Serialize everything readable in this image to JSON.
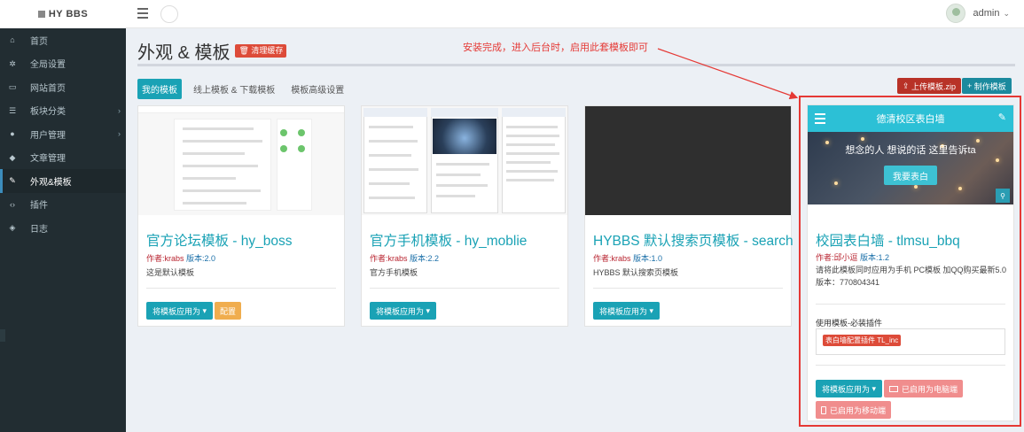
{
  "app": {
    "logo": "HY BBS"
  },
  "user": {
    "name": "admin",
    "caret": "⌄"
  },
  "sidebar": {
    "items": [
      {
        "label": "首页",
        "icon": "home-icon"
      },
      {
        "label": "全局设置",
        "icon": "gear-icon"
      },
      {
        "label": "网站首页",
        "icon": "monitor-icon"
      },
      {
        "label": "板块分类",
        "icon": "list-icon",
        "arrow": "›"
      },
      {
        "label": "用户管理",
        "icon": "users-icon",
        "arrow": "›"
      },
      {
        "label": "文章管理",
        "icon": "tag-icon"
      },
      {
        "label": "外观&模板",
        "icon": "brush-icon",
        "active": true
      },
      {
        "label": "插件",
        "icon": "code-icon"
      },
      {
        "label": "日志",
        "icon": "cube-icon"
      }
    ]
  },
  "page": {
    "title": "外观 & 模板",
    "clear_cache": "清理缓存",
    "annotation": "安装完成，进入后台时，启用此套模板即可"
  },
  "tabs": [
    {
      "label": "我的模板",
      "active": true
    },
    {
      "label": "线上模板 & 下载模板",
      "active": false
    },
    {
      "label": "模板高级设置",
      "active": false
    }
  ],
  "toolbar": {
    "upload": "上传模板.zip",
    "make": "制作模板"
  },
  "templates": [
    {
      "name": "官方论坛模板 - hy_boss",
      "author": "作者:krabs",
      "version": "版本:2.0",
      "desc": "这是默认模板",
      "apply": "将模板应用为",
      "config": "配置"
    },
    {
      "name": "官方手机模板 - hy_moblie",
      "author": "作者:krabs",
      "version": "版本:2.2",
      "desc": "官方手机模板",
      "apply": "将模板应用为"
    },
    {
      "name": "HYBBS 默认搜索页模板 - search",
      "author": "作者:krabs",
      "version": "版本:1.0",
      "desc": "HYBBS 默认搜索页模板",
      "apply": "将模板应用为"
    }
  ],
  "featured": {
    "header": "德清校区表白墙",
    "slogan": "想念的人 想说的话 这里告诉ta",
    "cta": "我要表白",
    "name": "校园表白墙 - tlmsu_bbq",
    "author": "作者:邱小逗",
    "version": "版本:1.2",
    "desc": "请将此模板同时应用为手机 PC模板 加QQ购买最新5.0版本：770804341",
    "plugins_label": "使用模板-必装插件",
    "plugin": "表白墙配置插件 TL_inc",
    "apply": "将模板应用为",
    "pc": "已启用为电脑端",
    "mobile": "已启用为移动端"
  },
  "colors": {
    "accent": "#1aa2b5",
    "sidebar_bg": "#222d32",
    "annotation_red": "#e53935"
  }
}
